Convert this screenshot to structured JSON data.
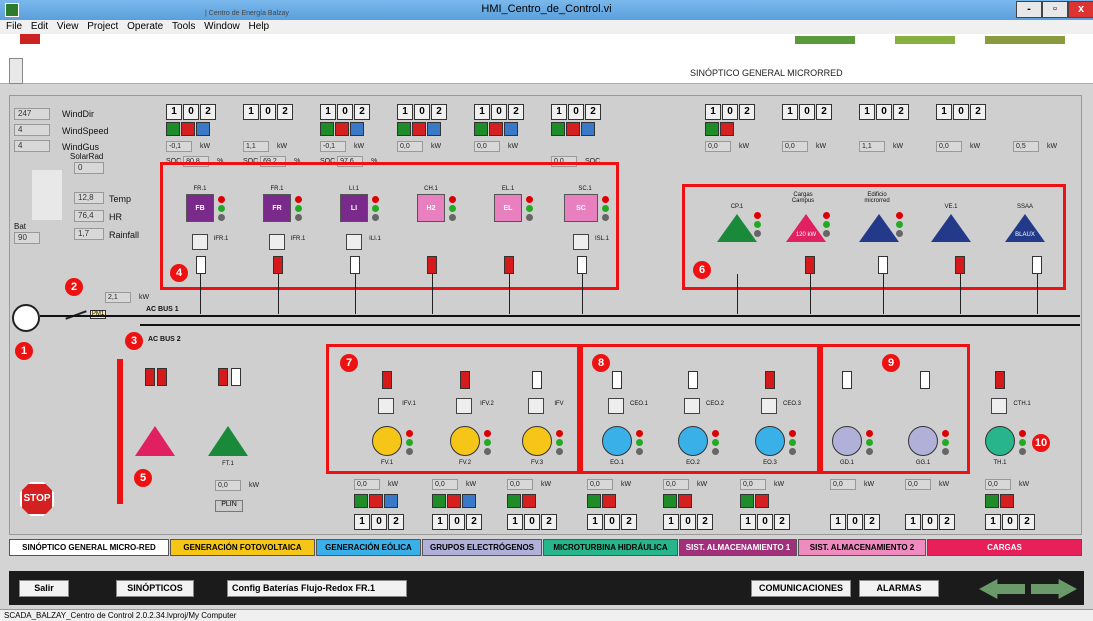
{
  "window": {
    "title": "HMI_Centro_de_Control.vi",
    "min": "-",
    "max": "▫",
    "close": "x"
  },
  "menu": [
    "File",
    "Edit",
    "View",
    "Project",
    "Operate",
    "Tools",
    "Window",
    "Help"
  ],
  "header": {
    "subtitle": "| Centro de Energía Balzay",
    "view_title": "SINÓPTICO GENERAL MICRORRED"
  },
  "weather": {
    "v1": "247",
    "l1": "WindDir",
    "v2": "4",
    "l2": "WindSpeed",
    "v3": "4",
    "l3": "WindGus",
    "l4": "SolarRad",
    "v4": "0",
    "v5": "12,8",
    "l5": "Temp",
    "v6": "76,4",
    "l6": "HR",
    "v7": "1,7",
    "l7": "Rainfall",
    "bat_label": "Bat",
    "bat_val": "90"
  },
  "switch": {
    "a": "1",
    "b": "0",
    "c": "2"
  },
  "kw_unit": "kW",
  "soc_unit": "%",
  "top_kw": [
    "-0,1",
    "1,1",
    "-0,1",
    "0,0",
    "0,0",
    "0,0",
    "0,0",
    "0,0",
    "1,1",
    "0,0",
    "0,5"
  ],
  "soc": {
    "l": "SOC",
    "v1": "80,8",
    "v2": "69,2",
    "v3": "97,6",
    "soc_last": "SOC"
  },
  "storage": [
    {
      "name": "FR.1",
      "conv": "IFR.1",
      "icon": "FB"
    },
    {
      "name": "FR.1",
      "conv": "IFR.1",
      "icon": "FR"
    },
    {
      "name": "LI.1",
      "conv": "ILI.1",
      "icon": "LI"
    },
    {
      "name": "CH.1",
      "conv": "",
      "icon": "H2"
    },
    {
      "name": "EL.1",
      "conv": "",
      "icon": "EL"
    },
    {
      "name": "SC.1",
      "conv": "ISL.1",
      "icon": "SC"
    }
  ],
  "loads": [
    {
      "name": "CP.1"
    },
    {
      "name": "Cargas Campus",
      "icon": "120 kW"
    },
    {
      "name": "Edificio microrred"
    },
    {
      "name": "VE.1"
    },
    {
      "name": "SSAA",
      "icon": "BLAUX"
    }
  ],
  "grid": {
    "kw": "2,1",
    "bus1": "AC BUS 1",
    "bus2": "AC BUS 2",
    "meter": "PM1"
  },
  "pv": [
    {
      "name": "FV.1",
      "conv": "IFV.1"
    },
    {
      "name": "FV.2",
      "conv": "IFV.2"
    },
    {
      "name": "FV.3",
      "conv": "IFV"
    }
  ],
  "wind": [
    {
      "name": "EO.1",
      "conv": "CEO.1"
    },
    {
      "name": "EO.2",
      "conv": "CEO.2"
    },
    {
      "name": "EO.3",
      "conv": "CEO.3"
    }
  ],
  "gen": [
    {
      "name": "GD.1"
    },
    {
      "name": "GG.1"
    }
  ],
  "hydro": {
    "name": "TH.1",
    "conv": "CTH.1"
  },
  "pcc": {
    "name": "FT.1",
    "kw": "0,0",
    "button": "PLIN"
  },
  "bottom_kw": [
    "0,0",
    "0,0",
    "0,0",
    "0,0",
    "0,0",
    "0,0",
    "0,0",
    "0,0",
    "0,0",
    "0,0"
  ],
  "numbers": [
    "1",
    "2",
    "3",
    "4",
    "5",
    "6",
    "7",
    "8",
    "9",
    "10"
  ],
  "stop": "STOP",
  "tabs": [
    {
      "label": "SINÓPTICO GENERAL MICRO-RED",
      "color": "#ffffff"
    },
    {
      "label": "GENERACIÓN FOTOVOLTAICA",
      "color": "#f5c518"
    },
    {
      "label": "GENERACIÓN EÓLICA",
      "color": "#3ab0e8"
    },
    {
      "label": "GRUPOS ELECTRÓGENOS",
      "color": "#b0b0d8"
    },
    {
      "label": "MICROTURBINA HIDRÁULICA",
      "color": "#27b58c"
    },
    {
      "label": "SIST. ALMACENAMIENTO 1",
      "color": "#a0307a"
    },
    {
      "label": "SIST. ALMACENAMIENTO 2",
      "color": "#f08bc0"
    },
    {
      "label": "CARGAS",
      "color": "#e8205a"
    }
  ],
  "buttons": {
    "salir": "Salir",
    "sinopticos": "SINÓPTICOS",
    "config": "Config Baterías Flujo-Redox FR.1",
    "comm": "COMUNICACIONES",
    "alarms": "ALARMAS"
  },
  "status": "SCADA_BALZAY_Centro de Control 2.0.2.34.lvproj/My Computer"
}
